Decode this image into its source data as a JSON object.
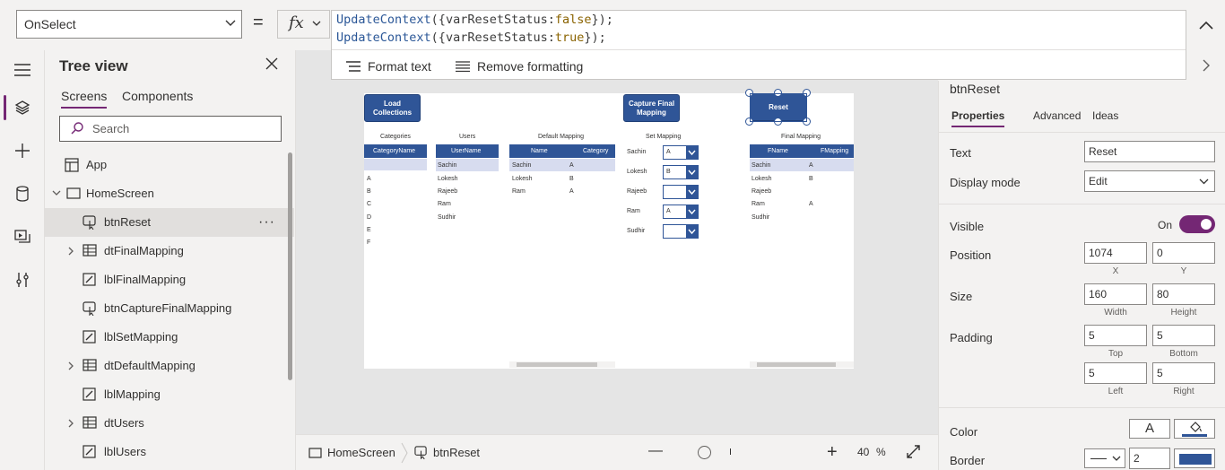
{
  "formula": {
    "property": "OnSelect",
    "equals": "=",
    "fx_label": "fx",
    "line1": {
      "fn": "UpdateContext",
      "open": "({",
      "prop": "varResetStatus",
      "colon": ":",
      "value": "false",
      "close": "});"
    },
    "line2": {
      "fn": "UpdateContext",
      "open": "({",
      "prop": "varResetStatus",
      "colon": ":",
      "value": "true",
      "close": "});"
    },
    "format_text": "Format text",
    "remove_formatting": "Remove formatting"
  },
  "rail": {
    "items": [
      "hamburger-icon",
      "layers-icon",
      "plus-icon",
      "database-icon",
      "media-icon",
      "tools-icon"
    ],
    "accent": "#742774"
  },
  "tree": {
    "title": "Tree view",
    "tabs": [
      "Screens",
      "Components"
    ],
    "search_placeholder": "Search",
    "rows": [
      {
        "label": "App",
        "icon": "app-icon",
        "indent": 0
      },
      {
        "label": "HomeScreen",
        "icon": "screen-icon",
        "indent": 0
      },
      {
        "label": "btnReset",
        "icon": "button-icon",
        "indent": 1
      },
      {
        "label": "dtFinalMapping",
        "icon": "table-icon",
        "indent": 1
      },
      {
        "label": "lblFinalMapping",
        "icon": "label-icon",
        "indent": 1
      },
      {
        "label": "btnCaptureFinalMapping",
        "icon": "button-icon",
        "indent": 1
      },
      {
        "label": "lblSetMapping",
        "icon": "label-icon",
        "indent": 1
      },
      {
        "label": "dtDefaultMapping",
        "icon": "table-icon",
        "indent": 1
      },
      {
        "label": "lblMapping",
        "icon": "label-icon",
        "indent": 1
      },
      {
        "label": "dtUsers",
        "icon": "table-icon",
        "indent": 1
      },
      {
        "label": "lblUsers",
        "icon": "label-icon",
        "indent": 1
      }
    ],
    "more": "···"
  },
  "canvas": {
    "load_button": "Load Collections",
    "capture_button": "Capture Final Mapping",
    "reset_button": "Reset",
    "categories": {
      "label": "Categories",
      "header": "CategoryName",
      "rows": [
        "",
        "A",
        "B",
        "C",
        "D",
        "E",
        "F"
      ]
    },
    "users": {
      "label": "Users",
      "header": "UserName",
      "rows": [
        "Sachin",
        "Lokesh",
        "Rajeeb",
        "Ram",
        "Sudhir"
      ]
    },
    "default_mapping": {
      "label": "Default Mapping",
      "headers": [
        "Name",
        "Category"
      ],
      "rows": [
        [
          "Sachin",
          "A"
        ],
        [
          "Lokesh",
          "B"
        ],
        [
          "Ram",
          "A"
        ]
      ]
    },
    "set_mapping": {
      "label": "Set Mapping",
      "rows": [
        [
          "Sachin",
          "A"
        ],
        [
          "Lokesh",
          "B"
        ],
        [
          "Rajeeb",
          ""
        ],
        [
          "Ram",
          "A"
        ],
        [
          "Sudhir",
          ""
        ]
      ]
    },
    "final_mapping": {
      "label": "Final Mapping",
      "headers": [
        "FName",
        "FMapping"
      ],
      "rows": [
        [
          "Sachin",
          "A"
        ],
        [
          "Lokesh",
          "B"
        ],
        [
          "Rajeeb",
          ""
        ],
        [
          "Ram",
          "A"
        ],
        [
          "Sudhir",
          ""
        ]
      ]
    }
  },
  "status": {
    "screen": "HomeScreen",
    "control": "btnReset",
    "zoom": "40",
    "zoom_unit": "%",
    "minus": "—",
    "plus": "+"
  },
  "props": {
    "component": "btnReset",
    "tabs": [
      "Properties",
      "Advanced",
      "Ideas"
    ],
    "text_label": "Text",
    "text_value": "Reset",
    "display_mode_label": "Display mode",
    "display_mode_value": "Edit",
    "visible_label": "Visible",
    "visible_value": "On",
    "position_label": "Position",
    "x": "1074",
    "y": "0",
    "x_label": "X",
    "y_label": "Y",
    "size_label": "Size",
    "width": "160",
    "height": "80",
    "width_label": "Width",
    "height_label": "Height",
    "padding_label": "Padding",
    "pad_top": "5",
    "pad_bottom": "5",
    "pad_left": "5",
    "pad_right": "5",
    "top_label": "Top",
    "bottom_label": "Bottom",
    "left_label": "Left",
    "right_label": "Right",
    "color_label": "Color",
    "color_text_glyph": "A",
    "border_label": "Border",
    "border_width": "2",
    "border_color": "#2f5597"
  }
}
